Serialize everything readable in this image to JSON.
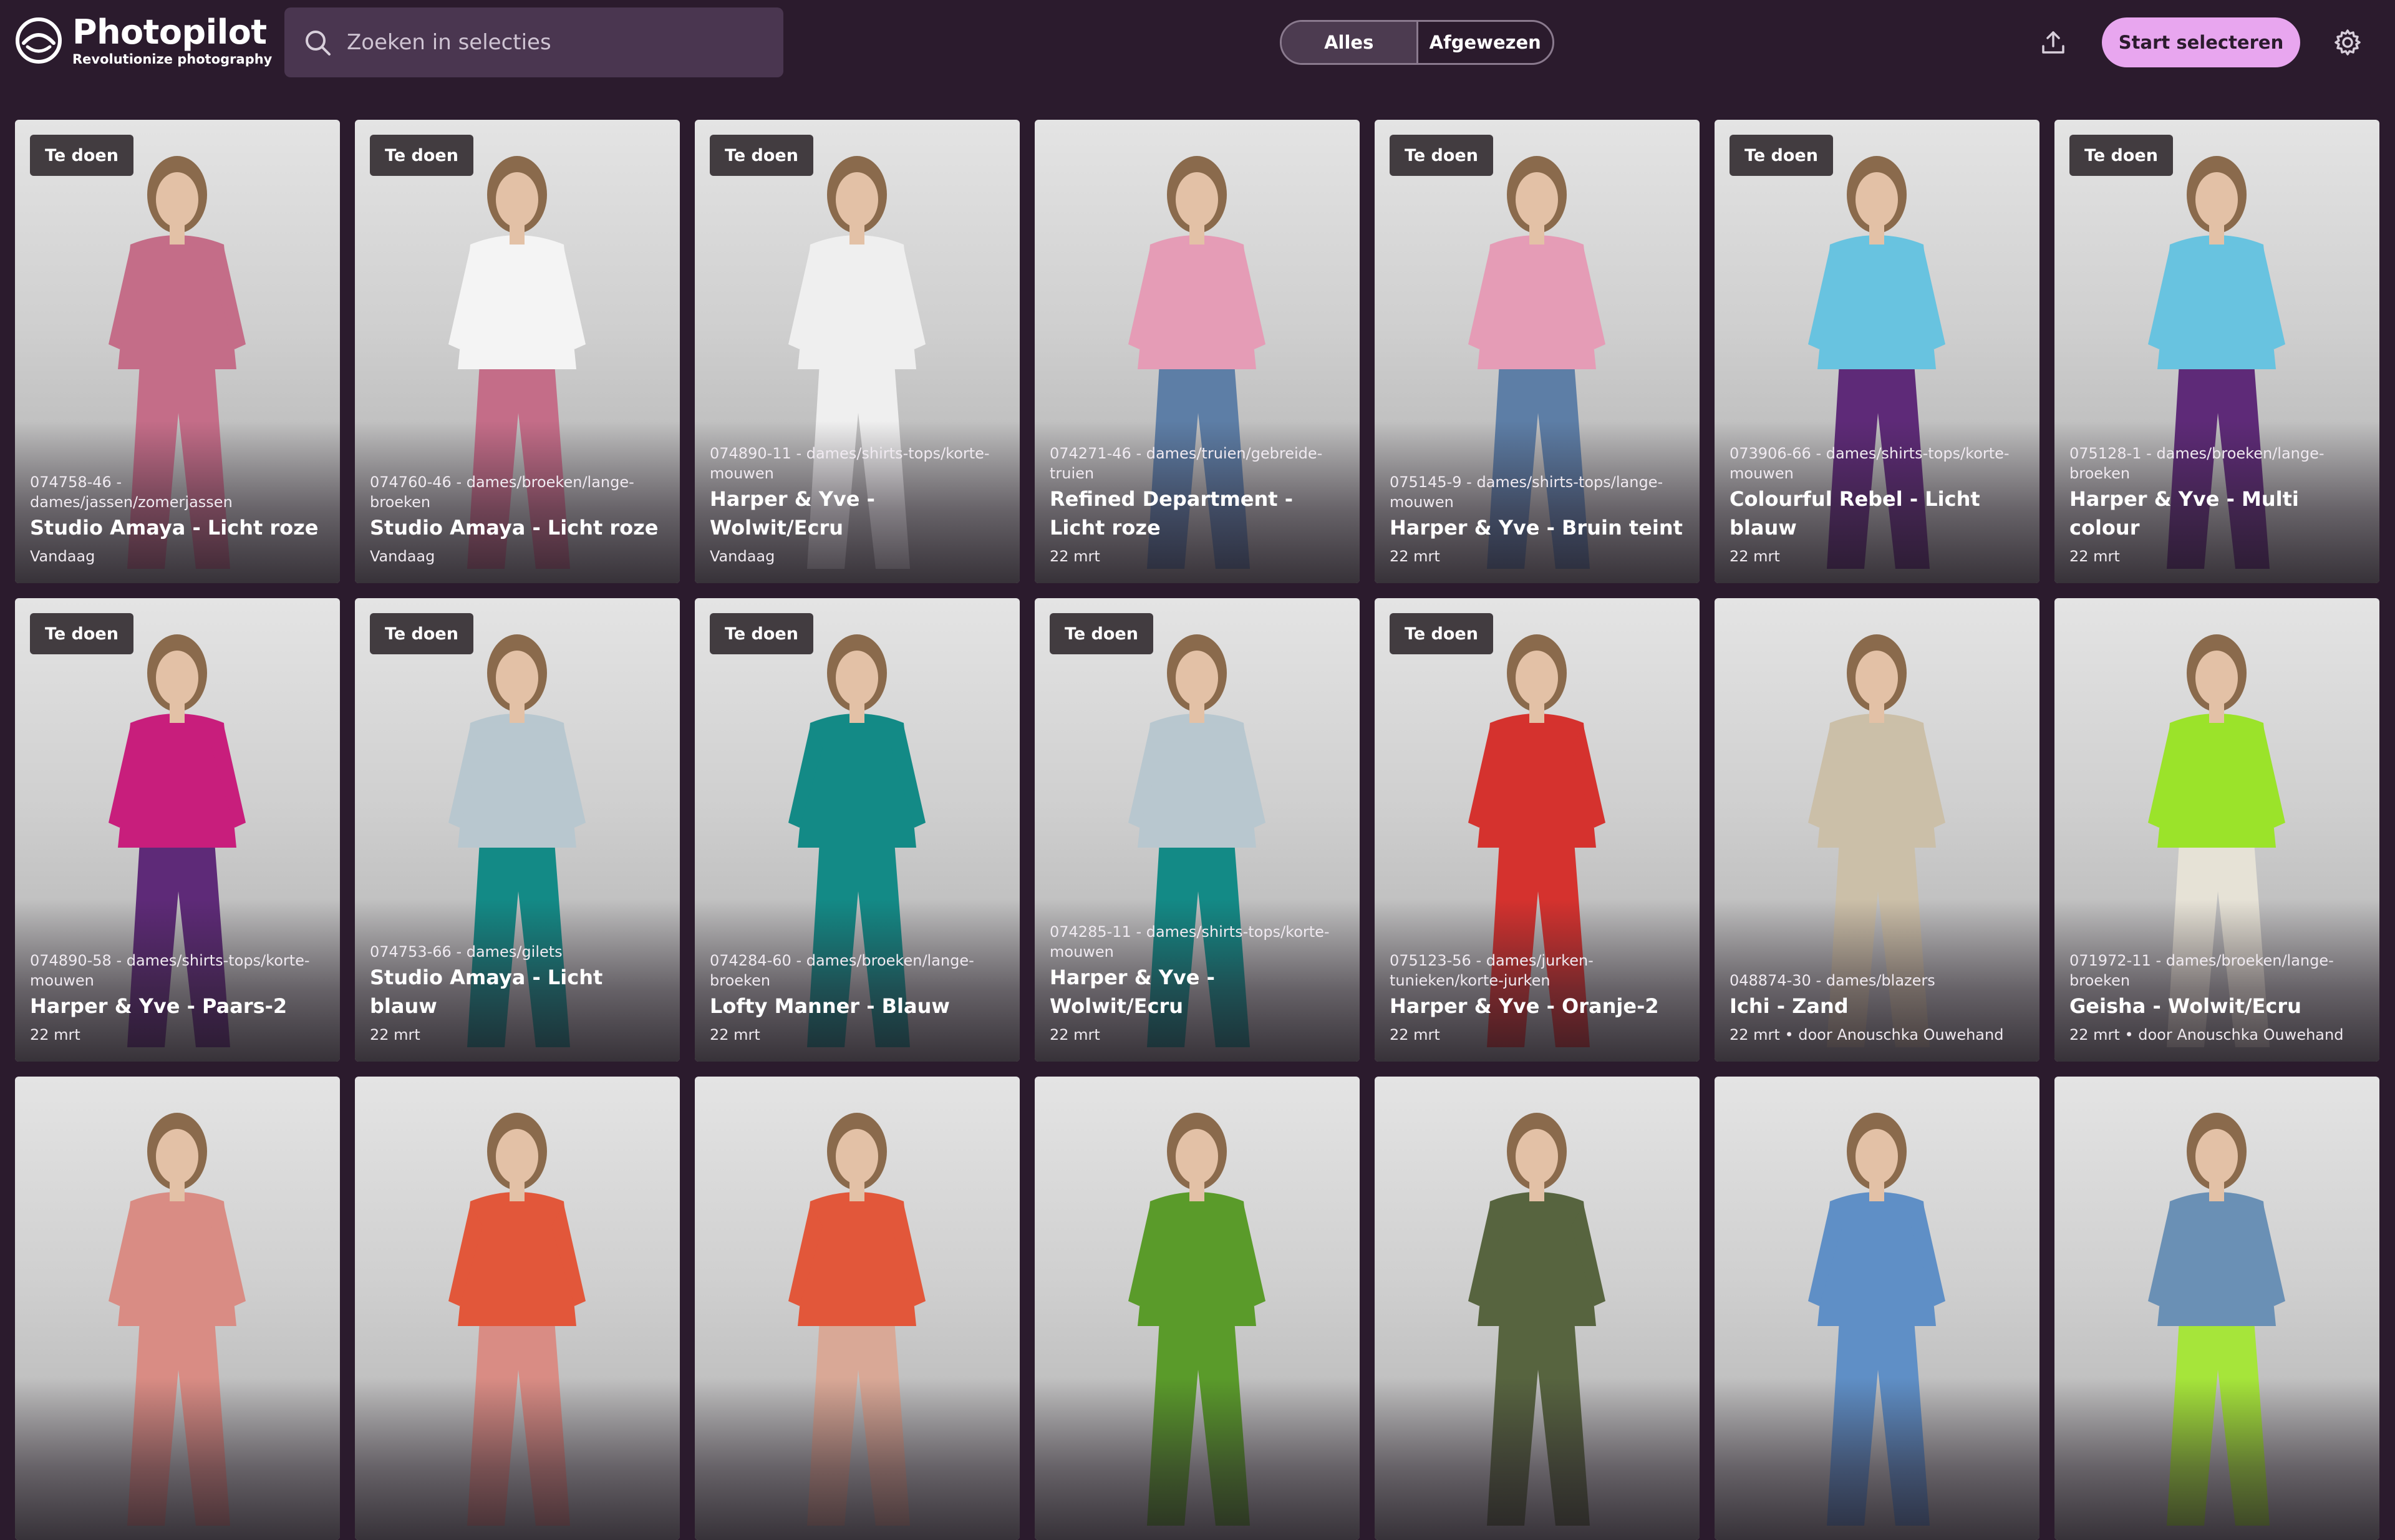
{
  "app": {
    "name": "Photopilot",
    "tagline": "Revolutionize photography"
  },
  "search": {
    "placeholder": "Zoeken in selecties"
  },
  "filter": {
    "options": [
      "Alles",
      "Afgewezen"
    ],
    "selected": "Alles"
  },
  "actions": {
    "start_label": "Start selecteren",
    "upload_icon": "upload-icon",
    "settings_icon": "gear-icon"
  },
  "colors": {
    "background": "#2b1b2d",
    "accent": "#e8a6ef",
    "search_bg": "#4a3650"
  },
  "cards": [
    {
      "badge": "Te doen",
      "sku": "074758-46 - dames/jassen/zomerjassen",
      "title": "Studio Amaya - Licht roze",
      "date": "Vandaag",
      "top": "#c46d88",
      "bottom": "#c46d88"
    },
    {
      "badge": "Te doen",
      "sku": "074760-46 - dames/broeken/lange-broeken",
      "title": "Studio Amaya - Licht roze",
      "date": "Vandaag",
      "top": "#f4f4f4",
      "bottom": "#c46d88"
    },
    {
      "badge": "Te doen",
      "sku": "074890-11 - dames/shirts-tops/korte-mouwen",
      "title": "Harper & Yve - Wolwit/Ecru",
      "date": "Vandaag",
      "top": "#efefef",
      "bottom": "#efefef"
    },
    {
      "badge": "",
      "sku": "074271-46 - dames/truien/gebreide-truien",
      "title": "Refined Department - Licht roze",
      "date": "22 mrt",
      "top": "#e59cb6",
      "bottom": "#5d7ea6"
    },
    {
      "badge": "Te doen",
      "sku": "075145-9 - dames/shirts-tops/lange-mouwen",
      "title": "Harper & Yve - Bruin teint",
      "date": "22 mrt",
      "top": "#e59cb6",
      "bottom": "#5d7ea6"
    },
    {
      "badge": "Te doen",
      "sku": "073906-66 - dames/shirts-tops/korte-mouwen",
      "title": "Colourful Rebel - Licht blauw",
      "date": "22 mrt",
      "top": "#68c3e0",
      "bottom": "#5e2a78"
    },
    {
      "badge": "Te doen",
      "sku": "075128-1 - dames/broeken/lange-broeken",
      "title": "Harper & Yve - Multi colour",
      "date": "22 mrt",
      "top": "#68c3e0",
      "bottom": "#5e2a78"
    },
    {
      "badge": "Te doen",
      "sku": "074890-58 - dames/shirts-tops/korte-mouwen",
      "title": "Harper & Yve - Paars-2",
      "date": "22 mrt",
      "top": "#c81e7c",
      "bottom": "#5e2a78"
    },
    {
      "badge": "Te doen",
      "sku": "074753-66 - dames/gilets",
      "title": "Studio Amaya - Licht blauw",
      "date": "22 mrt",
      "top": "#b8c7cf",
      "bottom": "#138a86"
    },
    {
      "badge": "Te doen",
      "sku": "074284-60 - dames/broeken/lange-broeken",
      "title": "Lofty Manner - Blauw",
      "date": "22 mrt",
      "top": "#138a86",
      "bottom": "#138a86"
    },
    {
      "badge": "Te doen",
      "sku": "074285-11 - dames/shirts-tops/korte-mouwen",
      "title": "Harper & Yve - Wolwit/Ecru",
      "date": "22 mrt",
      "top": "#b8c7cf",
      "bottom": "#138a86"
    },
    {
      "badge": "Te doen",
      "sku": "075123-56 - dames/jurken-tunieken/korte-jurken",
      "title": "Harper & Yve - Oranje-2",
      "date": "22 mrt",
      "top": "#d5322e",
      "bottom": "#d5322e"
    },
    {
      "badge": "",
      "sku": "048874-30 - dames/blazers",
      "title": "Ichi - Zand",
      "date": "22 mrt • door Anouschka Ouwehand",
      "top": "#cbbfa8",
      "bottom": "#cbbfa8"
    },
    {
      "badge": "",
      "sku": "071972-11 - dames/broeken/lange-broeken",
      "title": "Geisha - Wolwit/Ecru",
      "date": "22 mrt • door Anouschka Ouwehand",
      "top": "#9be32a",
      "bottom": "#e6e2d6"
    },
    {
      "badge": "",
      "sku": "",
      "title": "",
      "date": "",
      "top": "#d98c84",
      "bottom": "#d98c84"
    },
    {
      "badge": "",
      "sku": "",
      "title": "",
      "date": "",
      "top": "#e2573a",
      "bottom": "#d98c84"
    },
    {
      "badge": "",
      "sku": "",
      "title": "",
      "date": "",
      "top": "#e2573a",
      "bottom": "#d9a896"
    },
    {
      "badge": "",
      "sku": "",
      "title": "",
      "date": "",
      "top": "#5a9b2a",
      "bottom": "#5a9b2a"
    },
    {
      "badge": "",
      "sku": "",
      "title": "",
      "date": "",
      "top": "#57643f",
      "bottom": "#57643f"
    },
    {
      "badge": "",
      "sku": "",
      "title": "",
      "date": "",
      "top": "#5f8fc6",
      "bottom": "#5f8fc6"
    },
    {
      "badge": "",
      "sku": "",
      "title": "",
      "date": "",
      "top": "#6a90b5",
      "bottom": "#a6e53a"
    }
  ]
}
